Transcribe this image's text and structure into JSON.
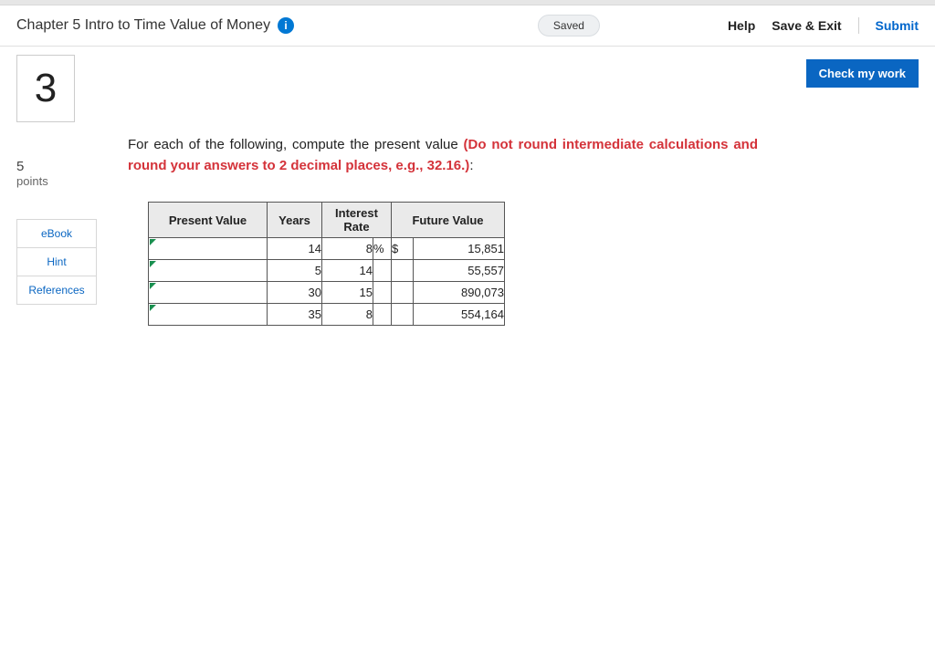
{
  "header": {
    "title": "Chapter 5 Intro to Time Value of Money",
    "info_glyph": "i",
    "saved": "Saved",
    "help": "Help",
    "save_exit": "Save & Exit",
    "submit": "Submit"
  },
  "actions": {
    "check_work": "Check my work"
  },
  "sidebar": {
    "question_number": "3",
    "points_num": "5",
    "points_label": "points",
    "ebook": "eBook",
    "hint": "Hint",
    "references": "References"
  },
  "prompt": {
    "lead": "For each of the following, compute the present value ",
    "red": "(Do not round intermediate calculations and round your answers to 2 decimal places, e.g., 32.16.)",
    "tail": ":"
  },
  "table": {
    "headers": {
      "pv": "Present Value",
      "years": "Years",
      "rate": "Interest Rate",
      "fv": "Future Value"
    },
    "rows": [
      {
        "years": "14",
        "rate_num": "8",
        "rate_sym": "%",
        "fv_sym": "$",
        "fv_num": "15,851"
      },
      {
        "years": "5",
        "rate_num": "14",
        "rate_sym": "",
        "fv_sym": "",
        "fv_num": "55,557"
      },
      {
        "years": "30",
        "rate_num": "15",
        "rate_sym": "",
        "fv_sym": "",
        "fv_num": "890,073"
      },
      {
        "years": "35",
        "rate_num": "8",
        "rate_sym": "",
        "fv_sym": "",
        "fv_num": "554,164"
      }
    ]
  }
}
